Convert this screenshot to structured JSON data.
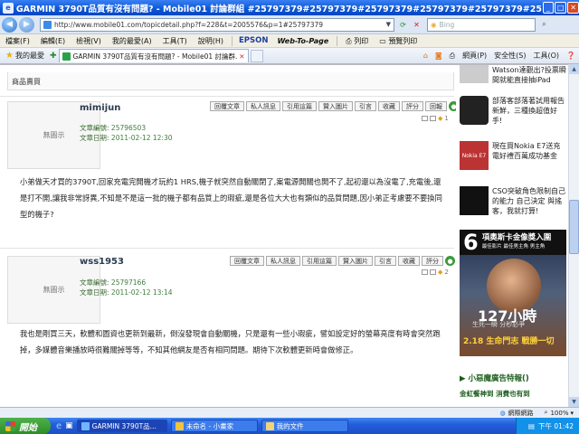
{
  "window": {
    "title": "GARMIN 3790T品質有沒有問題? - Mobile01 討論群組 #25797379#25797379#25797379#25797379#25797379#25797379#25797379 - Windows Internet..."
  },
  "address": {
    "url": "http://www.mobile01.com/topicdetail.php?f=228&t=2005576&p=1#25797379",
    "search_placeholder": "Bing"
  },
  "menu": {
    "items": [
      "檔案(F)",
      "編輯(E)",
      "檢視(V)",
      "我的最愛(A)",
      "工具(T)",
      "說明(H)"
    ],
    "epson": "EPSON",
    "webtopage": "Web-To-Page",
    "print": "列印",
    "preview": "預覽列印"
  },
  "favbar": {
    "favorites": "我的最愛",
    "tab_title": "GARMIN 3790T品質有沒有問題? - Mobile01 討論群...",
    "commands": [
      "網頁(P)",
      "安全性(S)",
      "工具(O)"
    ]
  },
  "page": {
    "strip_text": "商品賣買",
    "avatar_text": "無圖示",
    "label_number": "文章編號:",
    "label_date": "文章日期:",
    "post_actions": [
      "回覆文章",
      "私人訊息",
      "引用這篇",
      "贊入圖片",
      "引言",
      "收藏",
      "評分",
      "回報"
    ],
    "posts": [
      {
        "username": "mimijun",
        "number": "25796503",
        "date": "2011-02-12 12:30",
        "floor": "1",
        "body": "小弟做天才買的3790T,回家充電完開機才玩約1 HRS,機子就突然自動關閉了,案電源開關也開不了,起初還以為沒電了,充電後,還是打不開,讓我非常訝異,不知是不是這一批的機子都有品質上的瑕疵,還是各位大大也有類似的品質問題,因小弟正考慮要不要換同型的機子?"
      },
      {
        "username": "wss1953",
        "number": "25797166",
        "date": "2011-02-12 13:14",
        "floor": "2",
        "body": "我也是剛買三天，軟體和圖資也更新到最新，倒沒發現會自動關機，只是還有一些小瑕疵，譬如設定好的螢幕亮度有時會突然跑掉，多媒體音樂播放時很難關掉等等，不知其他網友是否有相同問題。期待下次軟體更新時會做修正。"
      }
    ]
  },
  "sidebar": {
    "ads": [
      {
        "text": "Watson達觀出?投票瞬間就能直接抽iPad"
      },
      {
        "text": "部落客部落著試用報告新鮮，三種換超值好手!"
      },
      {
        "text": "現在買Nokia E7送充電好禮百萬成功基金",
        "thumb": "Nokia E7"
      },
      {
        "text": "CSO突破角色限制自己的能力 自己決定 與搖客，我就打算!"
      }
    ],
    "bigad": {
      "num": "6",
      "headline": "項奧斯卡金像獎入圍",
      "sub": "最佳影片 最佳男主角 男主角",
      "hours": "127小時",
      "tagline": "生死一瞬 分秒必爭",
      "date": "2.18 生命門志 戰勝一切"
    },
    "section_title": "▶ 小惡魔廣告特報()",
    "link": "金虹餐神到 消費也有到"
  },
  "status": {
    "zone": "網際網路",
    "zoom": "100%"
  },
  "taskbar": {
    "start": "開始",
    "buttons": [
      "GARMIN 3790T品...",
      "未命名 - 小畫家",
      "我的文件"
    ],
    "time": "下午 01:42"
  },
  "colors": {
    "titlebar": "#0a55d6",
    "accent_green": "#3d7e3d",
    "sidebar_green": "#1c5d1c"
  }
}
